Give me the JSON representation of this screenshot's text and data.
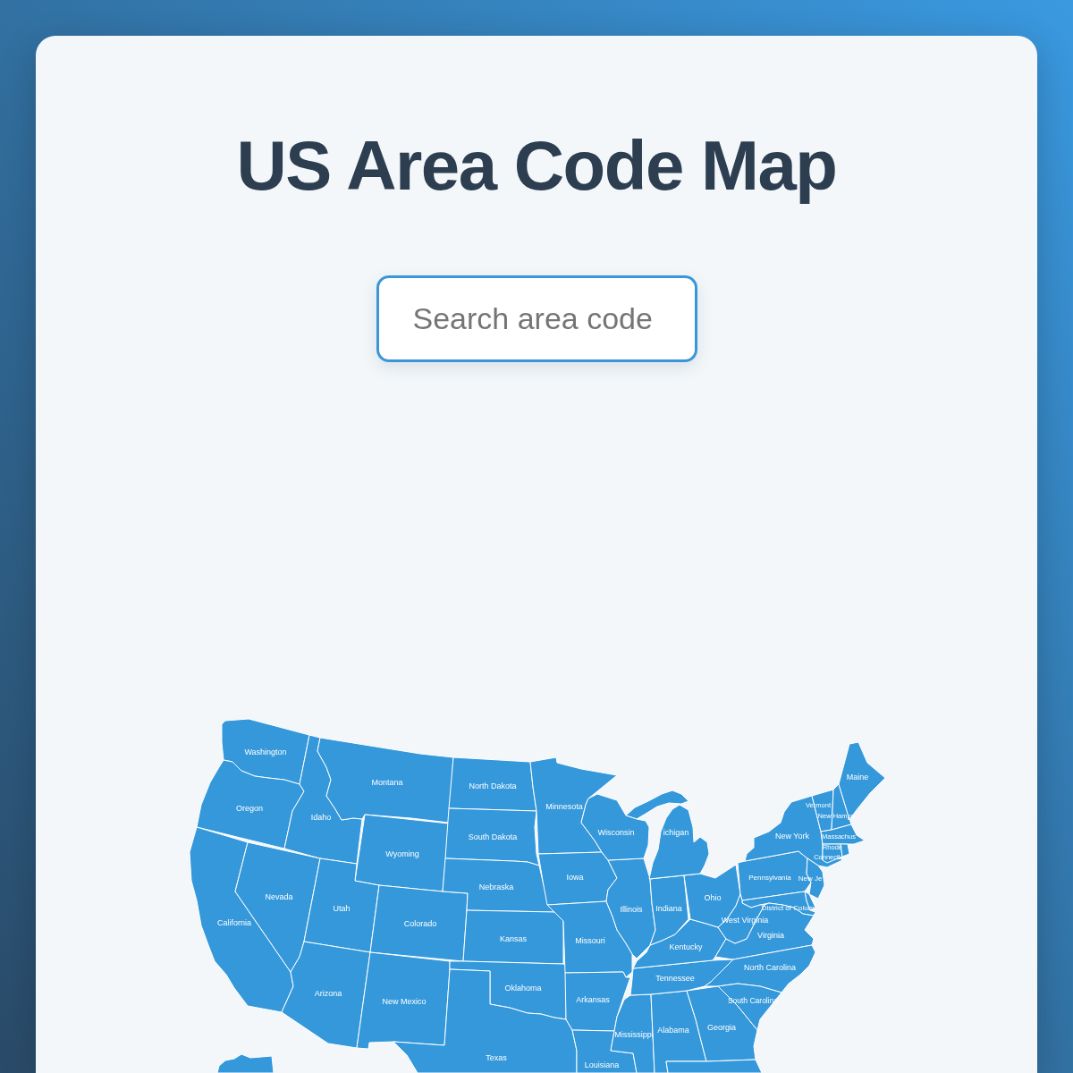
{
  "page": {
    "title": "US Area Code Map"
  },
  "search": {
    "placeholder": "Search area code"
  },
  "map": {
    "state_labels": [
      "Washington",
      "Montana",
      "North Dakota",
      "Maine",
      "Oregon",
      "Minnesota",
      "Vermont",
      "Idaho",
      "New Hamps",
      "South Dakota",
      "Wisconsin",
      "ichigan",
      "New York",
      "Massachus",
      "Wyoming",
      "Rhode",
      "Connecti",
      "Iowa",
      "Pennsylvania",
      "New Je",
      "Nebraska",
      "Nevada",
      "Ohio",
      "Utah",
      "Illinois",
      "Indiana",
      "District of Colum",
      "California",
      "Colorado",
      "West Virginia",
      "Kansas",
      "Missouri",
      "Virginia",
      "Kentucky",
      "North Carolina",
      "Tennessee",
      "Arizona",
      "Oklahoma",
      "New Mexico",
      "Arkansas",
      "South Carolina",
      "Mississippi",
      "Alabama",
      "Georgia",
      "Texas",
      "Louisiana"
    ]
  }
}
